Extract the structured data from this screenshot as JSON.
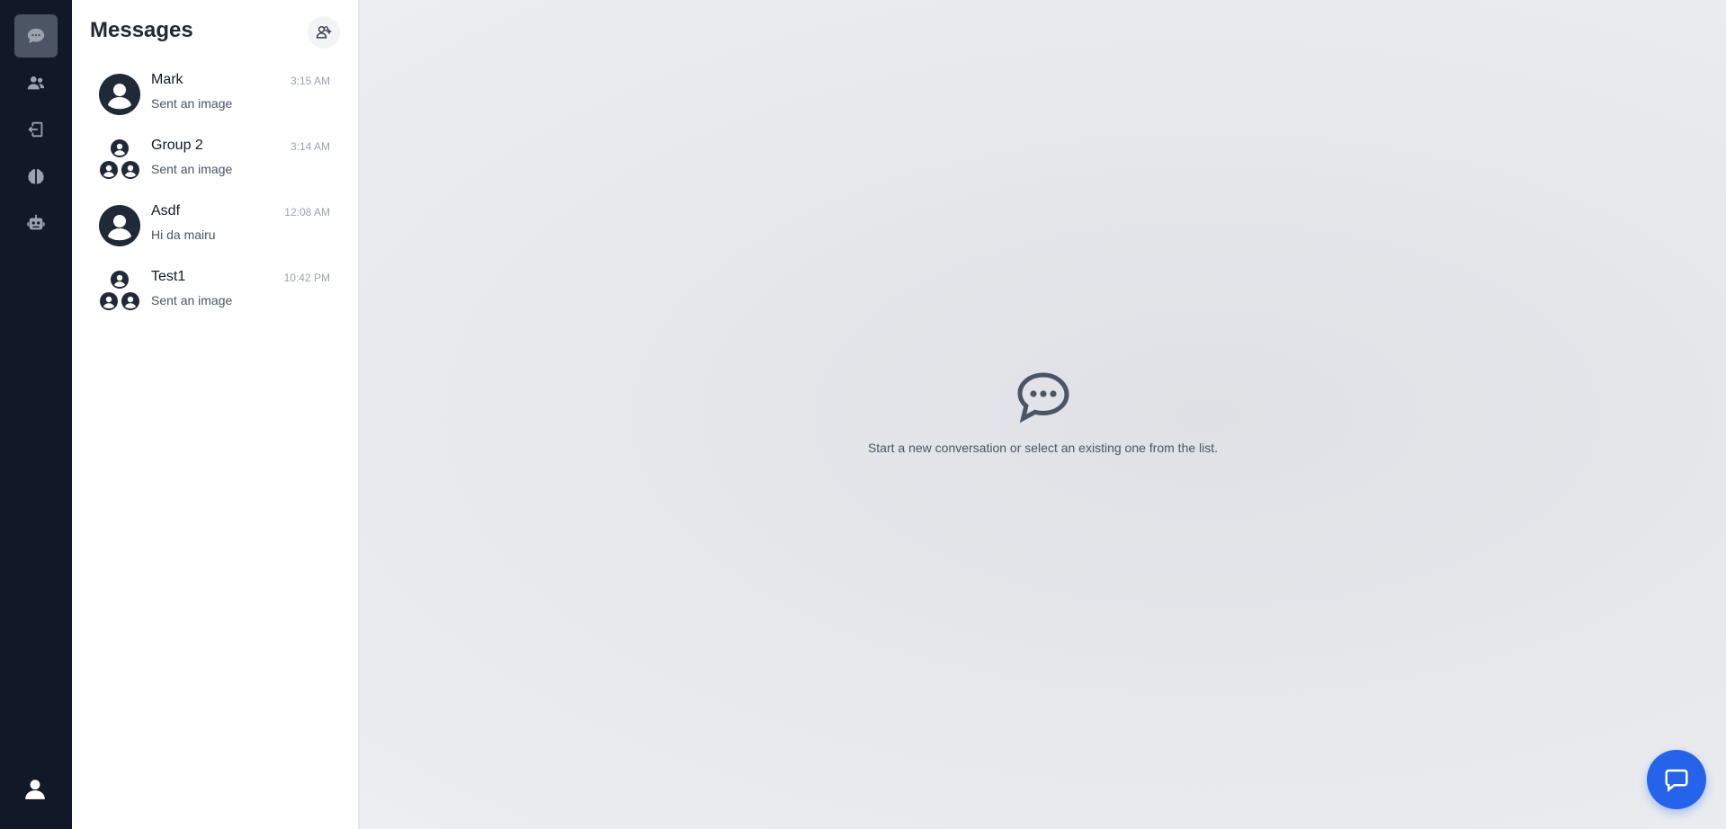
{
  "rail": {
    "items": [
      {
        "icon": "chat-bubble-icon",
        "active": true
      },
      {
        "icon": "users-icon",
        "active": false
      },
      {
        "icon": "logout-icon",
        "active": false
      },
      {
        "icon": "brain-icon",
        "active": false
      },
      {
        "icon": "robot-icon",
        "active": false
      }
    ],
    "avatar_icon": "user-avatar-icon"
  },
  "panel": {
    "title": "Messages",
    "new_button_icon": "add-user-icon"
  },
  "conversations": [
    {
      "name": "Mark",
      "preview": "Sent an image",
      "time": "3:15 AM",
      "type": "single"
    },
    {
      "name": "Group 2",
      "preview": "Sent an image",
      "time": "3:14 AM",
      "type": "group"
    },
    {
      "name": "Asdf",
      "preview": "Hi da mairu",
      "time": "12:08 AM",
      "type": "single"
    },
    {
      "name": "Test1",
      "preview": "Sent an image",
      "time": "10:42 PM",
      "type": "group"
    }
  ],
  "main": {
    "empty_text": "Start a new conversation or select an existing one from the list.",
    "empty_icon": "comment-dots-icon"
  },
  "fab": {
    "icon": "chat-icon"
  },
  "colors": {
    "rail_bg": "#111827",
    "rail_active": "#4b5563",
    "accent": "#2563eb",
    "panel_bg": "#ffffff",
    "main_bg": "#e5e7eb"
  }
}
